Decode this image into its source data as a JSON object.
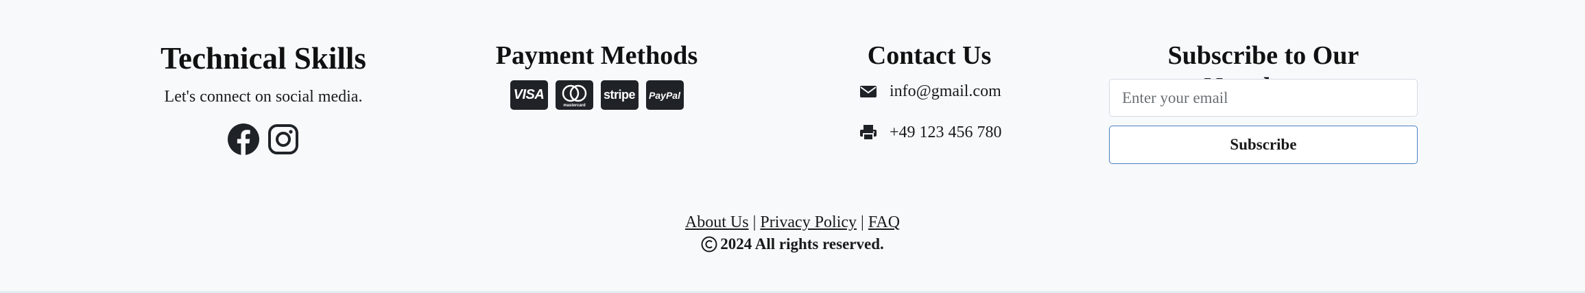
{
  "skills": {
    "title": "Technical Skills",
    "tagline": "Let's connect on social media.",
    "social_icons": [
      "facebook-icon",
      "instagram-icon"
    ]
  },
  "payment": {
    "title": "Payment Methods",
    "cards": [
      {
        "name": "visa-card-icon",
        "label": "VISA"
      },
      {
        "name": "mastercard-icon",
        "label": "mastercard"
      },
      {
        "name": "stripe-card-icon",
        "label": "stripe"
      },
      {
        "name": "paypal-card-icon",
        "label": "PayPal"
      }
    ]
  },
  "contact": {
    "title": "Contact Us",
    "email": "info@gmail.com",
    "phone": "+49 123 456 780"
  },
  "newsletter": {
    "title": "Subscribe to Our Newsletter",
    "placeholder": "Enter your email",
    "button_label": "Subscribe"
  },
  "bottom": {
    "links": [
      "About Us",
      "Privacy Policy",
      "FAQ"
    ],
    "separator": "|",
    "copyright": "2024 All rights reserved."
  },
  "colors": {
    "background": "#f7f9fb",
    "card_bg": "#1f2328",
    "button_border": "#4a7fc1"
  }
}
